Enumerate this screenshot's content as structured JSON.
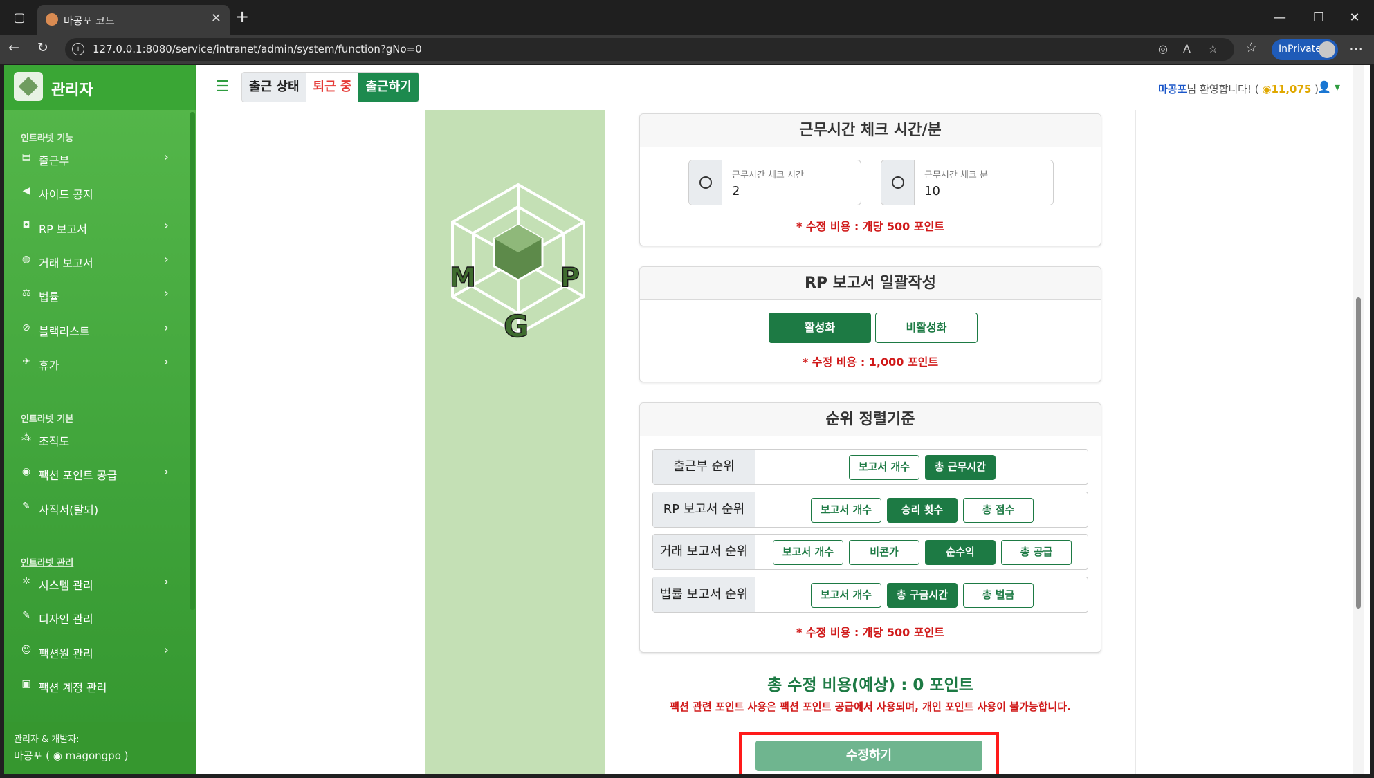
{
  "browser": {
    "tab_title": "마공포 코드",
    "url": "127.0.0.1:8080/service/intranet/admin/system/function?gNo=0",
    "inprivate": "InPrivate"
  },
  "sidebar": {
    "brand": "관리자",
    "sections": {
      "features": "인트라넷 기능",
      "basic": "인트라넷 기본",
      "manage": "인트라넷 관리"
    },
    "items": [
      {
        "label": "출근부",
        "icon": "book-icon",
        "chevron": true
      },
      {
        "label": "사이드 공지",
        "icon": "megaphone-icon",
        "chevron": false
      },
      {
        "label": "RP 보고서",
        "icon": "gamepad-icon",
        "chevron": true
      },
      {
        "label": "거래 보고서",
        "icon": "money-bag-icon",
        "chevron": true
      },
      {
        "label": "법률",
        "icon": "scale-icon",
        "chevron": true
      },
      {
        "label": "블랙리스트",
        "icon": "ban-icon",
        "chevron": true
      },
      {
        "label": "휴가",
        "icon": "plane-icon",
        "chevron": true
      },
      {
        "label": "조직도",
        "icon": "sitemap-icon",
        "chevron": false
      },
      {
        "label": "팩션 포인트 공급",
        "icon": "coins-icon",
        "chevron": true
      },
      {
        "label": "사직서(탈퇴)",
        "icon": "pen-icon",
        "chevron": false
      },
      {
        "label": "시스템 관리",
        "icon": "gear-icon",
        "chevron": true
      },
      {
        "label": "디자인 관리",
        "icon": "brush-icon",
        "chevron": false
      },
      {
        "label": "팩션원 관리",
        "icon": "user-gear-icon",
        "chevron": true
      },
      {
        "label": "팩션 계정 관리",
        "icon": "id-card-icon",
        "chevron": false
      }
    ],
    "footer": {
      "line1": "관리자 & 개발자:",
      "line2": "마공포 ( ",
      "handle": "magongpo",
      "close": " )"
    }
  },
  "topbar": {
    "status_label": "출근 상태",
    "status_value": "퇴근 중",
    "checkin_button": "출근하기",
    "welcome_name": "마공포",
    "welcome_text": "님 환영합니다! ( ",
    "points": "11,075",
    "welcome_end": " )"
  },
  "logo_letters": [
    "M",
    "G",
    "P"
  ],
  "work_time": {
    "title": "근무시간 체크 시간/분",
    "hour_label": "근무시간 체크 시간",
    "hour_value": "2",
    "minute_label": "근무시간 체크 분",
    "minute_value": "10",
    "cost": "* 수정 비용 : 개당 500 포인트"
  },
  "rp_bulk": {
    "title": "RP 보고서 일괄작성",
    "enable": "활성화",
    "disable": "비활성화",
    "selected": "활성화",
    "cost": "* 수정 비용 : 1,000 포인트"
  },
  "ranking": {
    "title": "순위 정렬기준",
    "rows": [
      {
        "label": "출근부 순위",
        "options": [
          "보고서 개수",
          "총 근무시간"
        ],
        "selected": 1
      },
      {
        "label": "RP 보고서 순위",
        "options": [
          "보고서 개수",
          "승리 횟수",
          "총 점수"
        ],
        "selected": 1
      },
      {
        "label": "거래 보고서 순위",
        "options": [
          "보고서 개수",
          "비콘가",
          "순수익",
          "총 공급"
        ],
        "selected": 2
      },
      {
        "label": "법률 보고서 순위",
        "options": [
          "보고서 개수",
          "총 구금시간",
          "총 벌금"
        ],
        "selected": 1
      }
    ],
    "cost": "* 수정 비용 : 개당 500 포인트"
  },
  "total_cost": "총 수정 비용(예상) : 0 포인트",
  "notice": "팩션 관련 포인트 사용은 팩션 포인트 공급에서 사용되며, 개인 포인트 사용이 불가능합니다.",
  "save_button": "수정하기",
  "colors": {
    "accent": "#1d7a44",
    "sidebar": "#3fa33a",
    "danger": "#d01a1a",
    "highlight_box": "#ff1a1a"
  }
}
